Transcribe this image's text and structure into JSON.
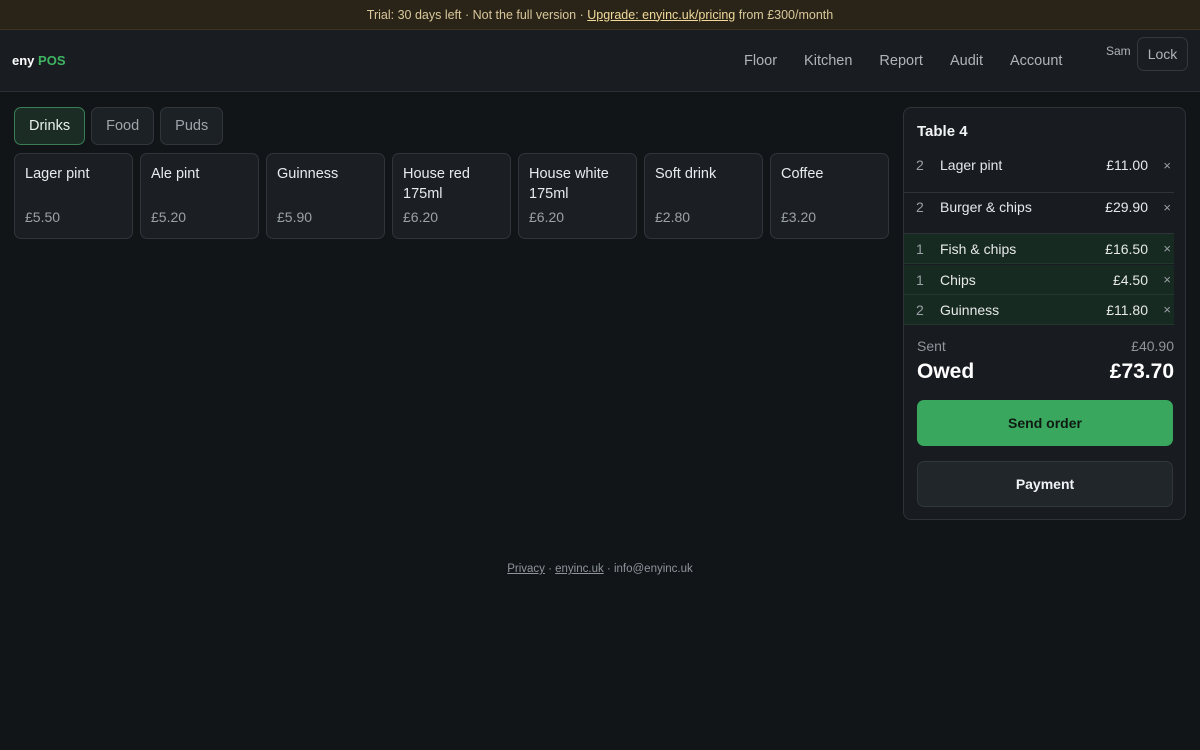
{
  "banner": {
    "trial": "Trial: 30 days left",
    "sep1": " · ",
    "not_full": "Not the full version",
    "sep2": " · ",
    "upgrade": "Upgrade: enyinc.uk/pricing",
    "from": " from £300/month"
  },
  "brand": {
    "part1": "eny",
    "part2": "POS"
  },
  "nav": [
    "Floor",
    "Kitchen",
    "Report",
    "Audit",
    "Account"
  ],
  "user": "Sam",
  "lock_label": "Lock",
  "tabs": [
    {
      "label": "Drinks",
      "active": true
    },
    {
      "label": "Food",
      "active": false
    },
    {
      "label": "Puds",
      "active": false
    }
  ],
  "products": [
    {
      "name": "Lager pint",
      "price": "£5.50"
    },
    {
      "name": "Ale pint",
      "price": "£5.20"
    },
    {
      "name": "Guinness",
      "price": "£5.90"
    },
    {
      "name": "House red 175ml",
      "price": "£6.20"
    },
    {
      "name": "House white 175ml",
      "price": "£6.20"
    },
    {
      "name": "Soft drink",
      "price": "£2.80"
    },
    {
      "name": "Coffee",
      "price": "£3.20"
    }
  ],
  "order": {
    "title": "Table 4",
    "pending": [
      {
        "qty": "2",
        "name": "Lager pint",
        "amount": "£11.00"
      },
      {
        "qty": "2",
        "name": "Burger & chips",
        "amount": "£29.90"
      }
    ],
    "sent_items": [
      {
        "qty": "1",
        "name": "Fish & chips",
        "amount": "£16.50"
      },
      {
        "qty": "1",
        "name": "Chips",
        "amount": "£4.50"
      },
      {
        "qty": "2",
        "name": "Guinness",
        "amount": "£11.80"
      }
    ],
    "remove_glyph": "×",
    "sent_label": "Sent",
    "sent_total": "£40.90",
    "owed_label": "Owed",
    "owed_total": "£73.70",
    "send_label": "Send order",
    "payment_label": "Payment"
  },
  "footer": {
    "privacy": "Privacy",
    "sep1": " · ",
    "site": "enyinc.uk",
    "sep2": " · ",
    "email": "info@enyinc.uk"
  },
  "colors": {
    "accent": "#3aa75e",
    "background": "#111518",
    "banner": "#2a2418"
  }
}
